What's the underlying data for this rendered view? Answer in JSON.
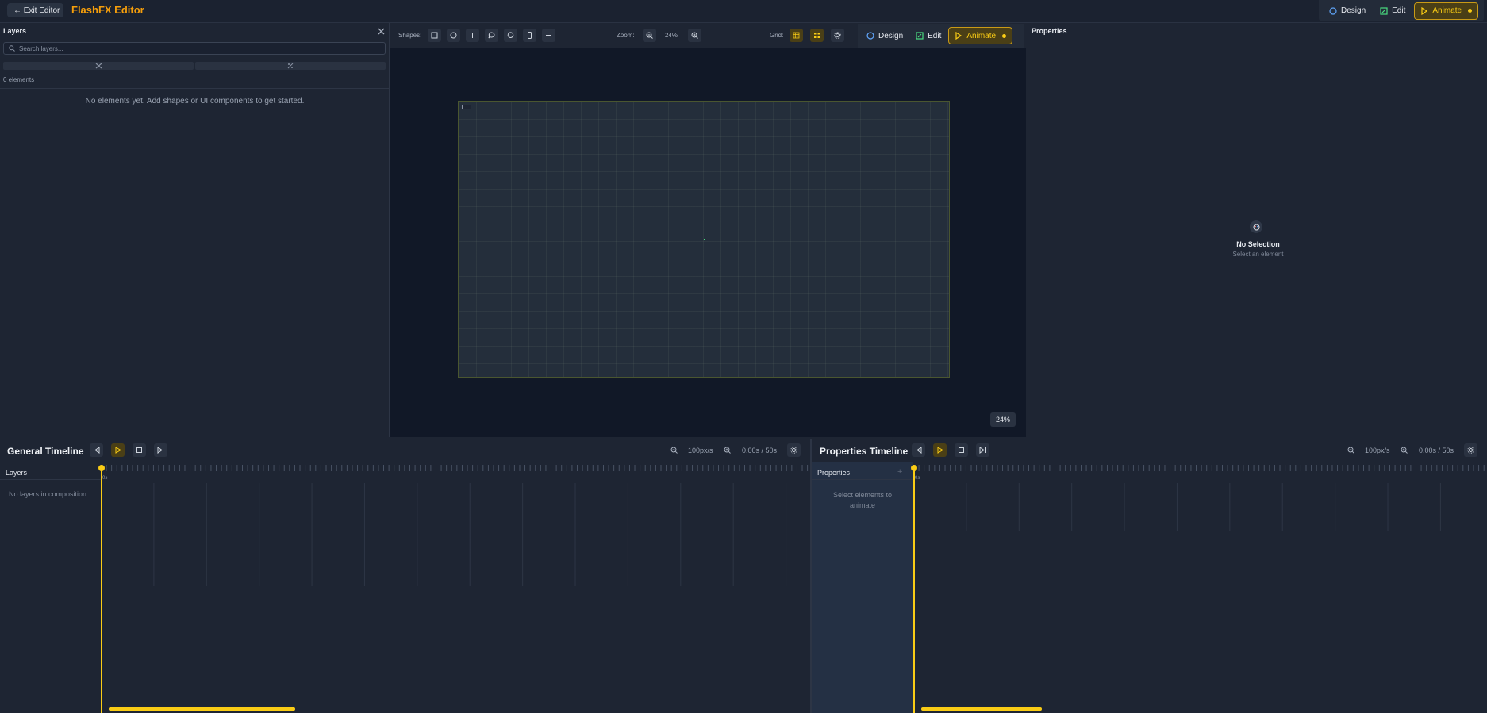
{
  "topbar": {
    "exit_label": "← Exit Editor",
    "app_title": "FlashFX Editor",
    "modes": [
      {
        "label": "Design",
        "icon": "palette-icon"
      },
      {
        "label": "Edit",
        "icon": "edit-icon"
      },
      {
        "label": "Animate",
        "icon": "play-icon",
        "active": true
      }
    ]
  },
  "layers_panel": {
    "title": "Layers",
    "search_placeholder": "Search layers...",
    "count": "0 elements",
    "empty_message": "No elements yet. Add shapes or UI components to get started."
  },
  "canvas_toolbar": {
    "shapes_label": "Shapes:",
    "shape_tools": [
      "rectangle-icon",
      "circle-icon",
      "text-icon",
      "speech-bubble-icon",
      "chat-bubble-icon",
      "phone-icon",
      "line-icon"
    ],
    "zoom_label": "Zoom:",
    "zoom_value": "24%",
    "grid_label": "Grid:",
    "modes": [
      {
        "label": "Design",
        "icon": "palette-icon"
      },
      {
        "label": "Edit",
        "icon": "edit-icon"
      },
      {
        "label": "Animate",
        "icon": "play-icon",
        "active": true
      }
    ]
  },
  "canvas": {
    "zoom_badge": "24%"
  },
  "properties_panel": {
    "title": "Properties",
    "empty_title": "No Selection",
    "empty_subtitle": "Select an element"
  },
  "general_timeline": {
    "title": "General Timeline",
    "scale": "100px/s",
    "time": "0.00s / 50s",
    "side_title": "Layers",
    "empty_message": "No layers in composition",
    "ruler_start": "0s"
  },
  "properties_timeline": {
    "title": "Properties Timeline",
    "scale": "100px/s",
    "time": "0.00s / 50s",
    "side_title": "Properties",
    "add_label": "+",
    "empty_message": "Select elements to animate",
    "ruler_start": "0s"
  },
  "colors": {
    "accent": "#f59e0b",
    "active_yellow": "#facc15",
    "background": "#1e2533",
    "canvas_bg": "#111827"
  }
}
